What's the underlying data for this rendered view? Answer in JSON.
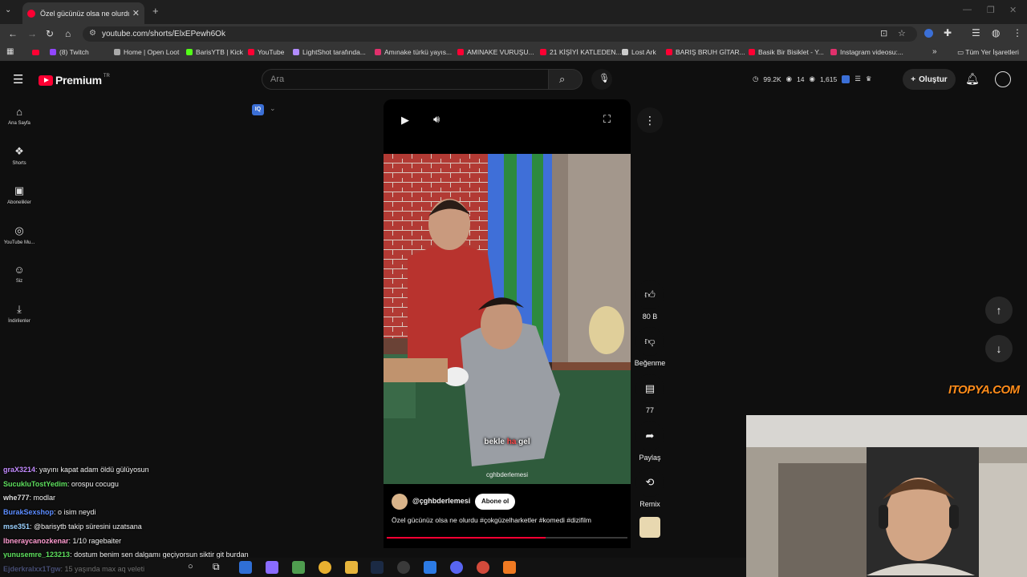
{
  "browser": {
    "tab_title": "Özel gücünüz olsa ne olurdu #...",
    "tab_close": "✕",
    "new_tab": "+",
    "url": "youtube.com/shorts/ElxEPewh6Ok",
    "bookmarks": [
      {
        "label": "(8) Twitch",
        "color": "#9146ff"
      },
      {
        "label": "Home | Open Loot",
        "color": "#aaaaaa"
      },
      {
        "label": "BarisYTB | Kick",
        "color": "#53fc18"
      },
      {
        "label": "YouTube",
        "color": "#ff0033"
      },
      {
        "label": "LightShot tarafında...",
        "color": "#b28cff"
      },
      {
        "label": "Amınake türkü yayıs...",
        "color": "#e1306c"
      },
      {
        "label": "AMINAKE VURUŞU...",
        "color": "#ff0033"
      },
      {
        "label": "21 KİŞİYİ KATLEDEN...",
        "color": "#ff0033"
      },
      {
        "label": "Lost Ark",
        "color": "#cccccc"
      },
      {
        "label": "BARIŞ BRUH GİTAR...",
        "color": "#ff0033"
      },
      {
        "label": "Basik Bir Bisiklet - Y...",
        "color": "#ff0033"
      },
      {
        "label": "Instagram videosu:...",
        "color": "#e1306c"
      }
    ],
    "all_bookmarks": "Tüm Yer İşaretleri"
  },
  "youtube": {
    "logo_text": "Premium",
    "logo_region": "TR",
    "search_placeholder": "Ara",
    "stats": {
      "views": "99.2K",
      "a": "14",
      "b": "1,615"
    },
    "create_label": "Oluştur",
    "sidebar": [
      {
        "label": "Ana Sayfa",
        "icon": "home-icon",
        "glyph": "⌂"
      },
      {
        "label": "Shorts",
        "icon": "shorts-icon",
        "glyph": "❖"
      },
      {
        "label": "Abonelikler",
        "icon": "subscriptions-icon",
        "glyph": "▣"
      },
      {
        "label": "YouTube Mu...",
        "icon": "music-icon",
        "glyph": "◎"
      },
      {
        "label": "Siz",
        "icon": "you-icon",
        "glyph": "☺"
      },
      {
        "label": "İndirilenler",
        "icon": "download-icon",
        "glyph": "⤓"
      }
    ]
  },
  "short": {
    "subtitle_a": "bekle",
    "subtitle_b": "ha",
    "subtitle_c": "gel",
    "watermark": "cghbderlemesi",
    "channel": "@çghbderlemesi",
    "subscribe": "Abone ol",
    "title": "Özel gücünüz olsa ne olurdu #çokgüzelharketler #komedi #dizifilm",
    "progress": 0.66,
    "likes": "80 B",
    "dislike_label": "Beğenme",
    "comments": "77",
    "share_label": "Paylaş",
    "remix_label": "Remix"
  },
  "chat": [
    {
      "user": "graX3214",
      "color": "#c38bff",
      "msg": ": yayını kapat adam öldü gülüyosun"
    },
    {
      "user": "SucukluTostYedim",
      "color": "#5ee05e",
      "msg": ": orospu cocugu"
    },
    {
      "user": "whe777",
      "color": "#dddddd",
      "msg": ": modlar"
    },
    {
      "user": "BurakSexshop",
      "color": "#5b8cff",
      "msg": ": o isim neydi"
    },
    {
      "user": "mse351",
      "color": "#9ad1ff",
      "msg": ": @barisytb takip süresini uzatsana"
    },
    {
      "user": "lbneraycanozkenar",
      "color": "#ff9bd0",
      "msg": ": 1/10 ragebaiter"
    },
    {
      "user": "yunusemre_123213",
      "color": "#5ee05e",
      "msg": ": dostum benim sen dalgamı geçiyorsun siktir git burdan"
    },
    {
      "user": "Ejderkralxx1Tgw",
      "color": "#8fa0ff",
      "msg": ": 15 yaşında max aq veleti"
    }
  ],
  "overlay": {
    "sponsor": "ITOPYA.COM"
  }
}
